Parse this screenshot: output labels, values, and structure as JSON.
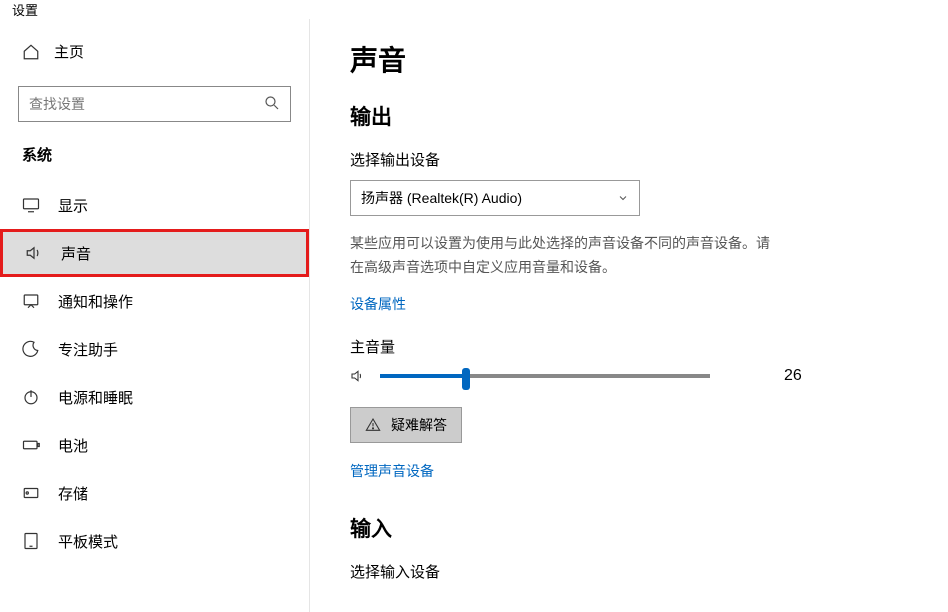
{
  "window": {
    "title": "设置"
  },
  "sidebar": {
    "home": "主页",
    "searchPlaceholder": "查找设置",
    "category": "系统",
    "items": [
      {
        "label": "显示"
      },
      {
        "label": "声音"
      },
      {
        "label": "通知和操作"
      },
      {
        "label": "专注助手"
      },
      {
        "label": "电源和睡眠"
      },
      {
        "label": "电池"
      },
      {
        "label": "存储"
      },
      {
        "label": "平板模式"
      }
    ]
  },
  "main": {
    "title": "声音",
    "output": {
      "heading": "输出",
      "deviceLabel": "选择输出设备",
      "deviceSelected": "扬声器 (Realtek(R) Audio)",
      "hint": "某些应用可以设置为使用与此处选择的声音设备不同的声音设备。请在高级声音选项中自定义应用音量和设备。",
      "propsLink": "设备属性",
      "volumeLabel": "主音量",
      "volumeValue": "26",
      "volumePercent": 26,
      "troubleshoot": "疑难解答",
      "manageLink": "管理声音设备"
    },
    "input": {
      "heading": "输入",
      "deviceLabel": "选择输入设备"
    }
  }
}
